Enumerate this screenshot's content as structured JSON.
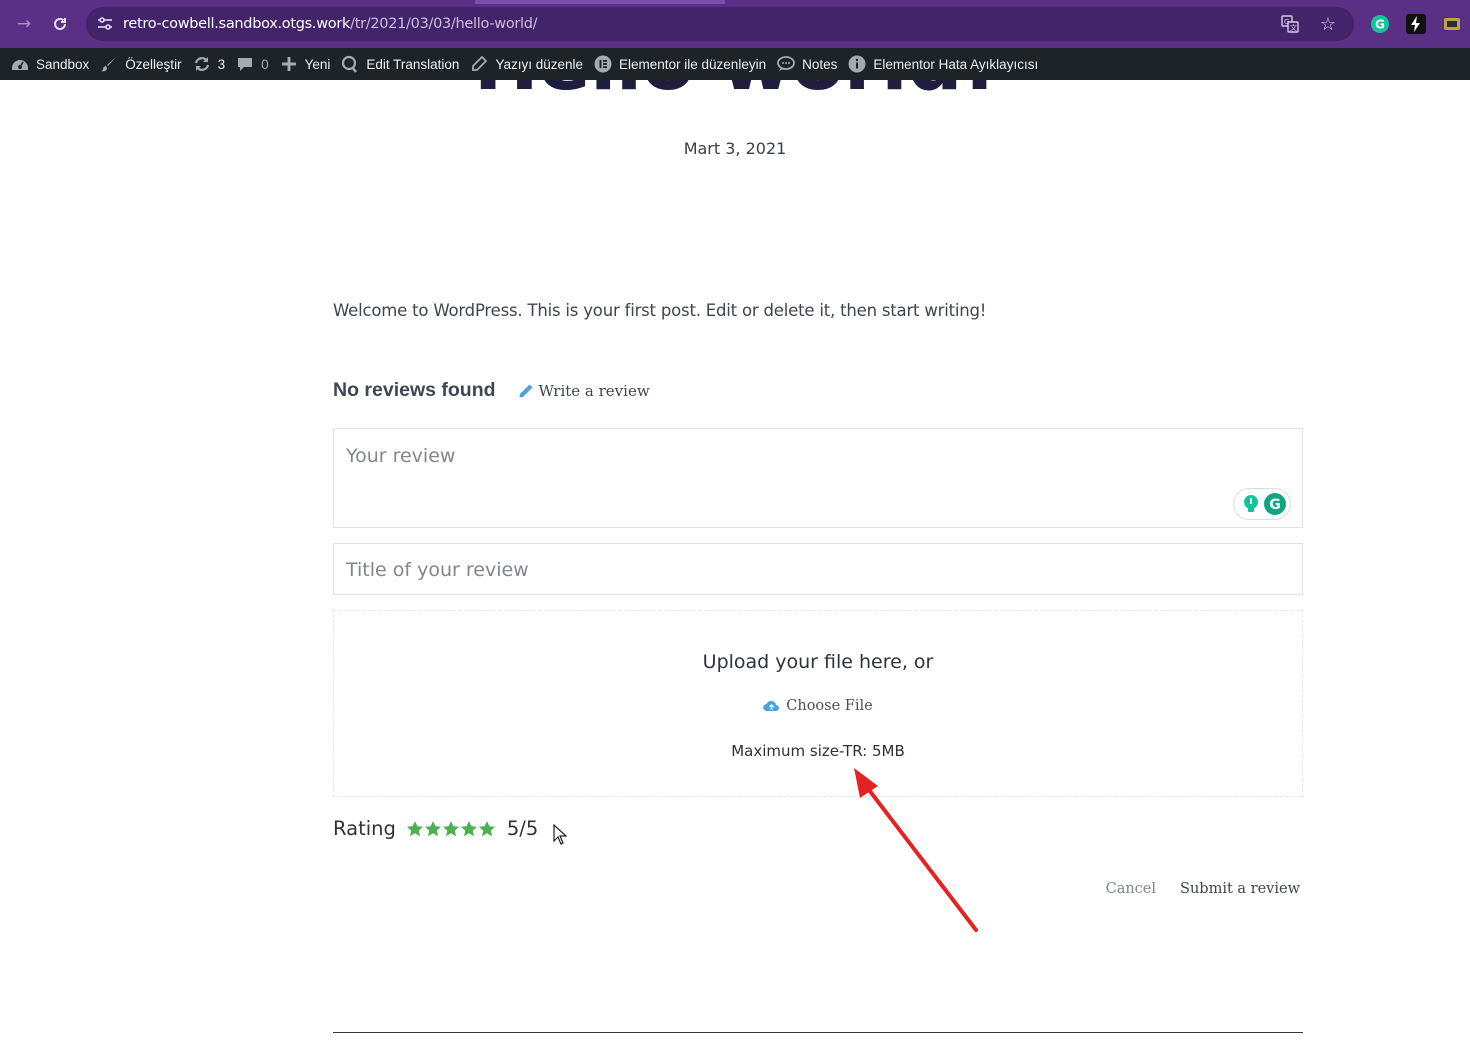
{
  "browser": {
    "url_host": "retro-cowbell.sandbox.otgs.work",
    "url_path": "/tr/2021/03/03/hello-world/",
    "icons": [
      "forward-icon",
      "reload-icon",
      "site-settings-icon",
      "translate-icon",
      "bookmark-star-icon",
      "grammarly-extension-icon",
      "bolt-extension-icon",
      "extension-icon"
    ]
  },
  "admin_bar": {
    "items": [
      {
        "label": "Sandbox",
        "icon": "dashboard-icon"
      },
      {
        "label": "Özelleştir",
        "icon": "brush-icon"
      },
      {
        "label": "3",
        "icon": "updates-icon"
      },
      {
        "label": "0",
        "icon": "comments-icon"
      },
      {
        "label": "Yeni",
        "icon": "plus-icon"
      },
      {
        "label": "Edit Translation",
        "icon": "translate-icon"
      },
      {
        "label": "Yazıyı düzenle",
        "icon": "pencil-icon"
      },
      {
        "label": "Elementor ile düzenleyin",
        "icon": "elementor-icon"
      },
      {
        "label": "Notes",
        "icon": "notes-icon"
      },
      {
        "label": "Elementor Hata Ayıklayıcısı",
        "icon": "info-icon"
      }
    ]
  },
  "post": {
    "title": "Hello world!",
    "date": "Mart 3, 2021",
    "body": "Welcome to WordPress. This is your first post. Edit or delete it, then start writing!"
  },
  "reviews": {
    "heading": "No reviews found",
    "write_link": "Write a review",
    "review_placeholder": "Your review",
    "title_placeholder": "Title of your review",
    "upload_title": "Upload your file here, or",
    "choose_file": "Choose File",
    "max_size": "Maximum size-TR: 5MB",
    "rating_label": "Rating",
    "rating_value": "5/5",
    "rating_stars": 5,
    "rating_max": 5,
    "cancel": "Cancel",
    "submit": "Submit a review"
  },
  "colors": {
    "browser_frame": "#5a2f86",
    "omnibox": "#43236a",
    "admin_bar": "#1d2327",
    "star": "#4caf50",
    "annotation_arrow": "#e52222",
    "link_icon": "#4aa3df"
  }
}
